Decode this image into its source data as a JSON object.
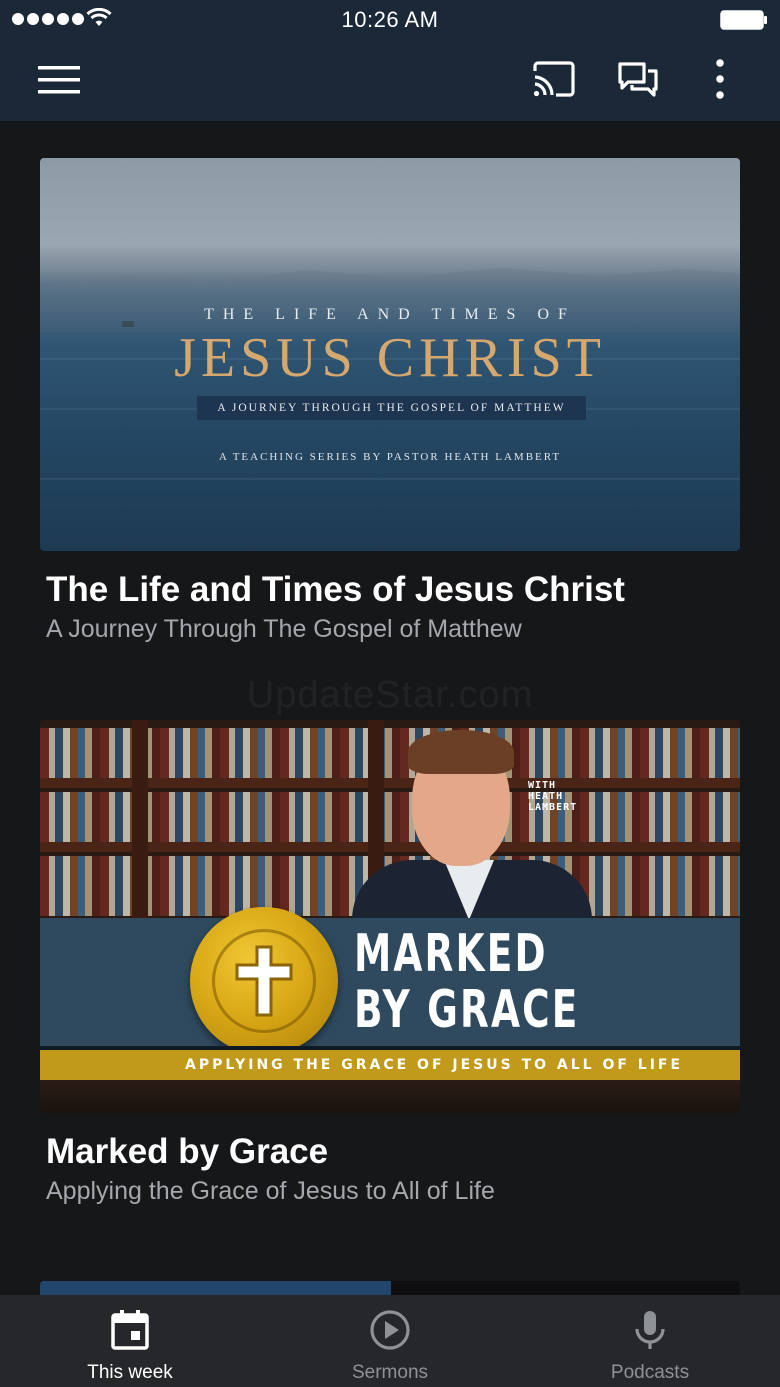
{
  "status_bar": {
    "time": "10:26 AM"
  },
  "app_bar": {
    "icons": [
      "menu-icon",
      "cast-icon",
      "chat-icon",
      "more-vertical-icon"
    ]
  },
  "cards": [
    {
      "artwork": {
        "pre_title": "THE LIFE AND TIMES OF",
        "main_title": "JESUS CHRIST",
        "band_text": "A JOURNEY THROUGH THE GOSPEL OF MATTHEW",
        "footer_text": "A TEACHING SERIES BY PASTOR HEATH LAMBERT"
      },
      "title": "The Life and Times of Jesus Christ",
      "subtitle": "A Journey Through The Gospel of Matthew"
    },
    {
      "artwork": {
        "with_label": "WITH\nHEATH\nLAMBERT",
        "main_title": "MARKED\nBY GRACE",
        "band_text": "APPLYING THE GRACE OF JESUS TO ALL OF LIFE"
      },
      "title": "Marked by Grace",
      "subtitle": "Applying the Grace of Jesus to All of Life"
    }
  ],
  "watermark": "UpdateStar.com",
  "tabs": [
    {
      "label": "This week",
      "icon": "calendar-icon",
      "active": true
    },
    {
      "label": "Sermons",
      "icon": "play-circle-icon",
      "active": false
    },
    {
      "label": "Podcasts",
      "icon": "microphone-icon",
      "active": false
    }
  ],
  "colors": {
    "app_bar": "#1b2838",
    "background": "#161719",
    "tab_bar": "#26272a",
    "accent_gold": "#c19a1c"
  }
}
